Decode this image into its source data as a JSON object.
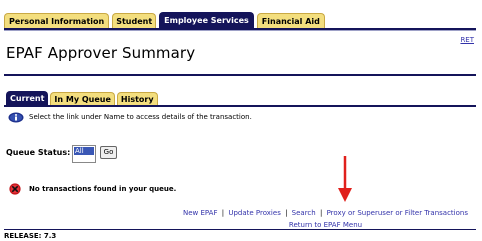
{
  "top_tabs": {
    "personal_information": "Personal Information",
    "student": "Student",
    "employee_services": "Employee Services",
    "financial_aid": "Financial Aid"
  },
  "ret_link": "RET",
  "page_title": "EPAF Approver Summary",
  "sub_tabs": {
    "current": "Current",
    "in_my_queue": "In My Queue",
    "history": "History"
  },
  "info": {
    "text": "Select the link under Name to access details of the transaction.",
    "icon": "info-icon"
  },
  "queue": {
    "label": "Queue Status:",
    "selected": "All",
    "go_label": "Go"
  },
  "message": {
    "text": "No transactions found in your queue.",
    "icon": "error-icon"
  },
  "links": {
    "new_epaf": "New EPAF",
    "update_proxies": "Update Proxies",
    "search": "Search",
    "proxy_filter": "Proxy or Superuser or Filter Transactions",
    "return_menu": "Return to EPAF Menu",
    "separator": "|"
  },
  "release": "RELEASE: 7.3",
  "colors": {
    "navy": "#14145a",
    "tab_gold": "#f3de7e",
    "link_blue": "#3333aa",
    "arrow_red": "#e0201c"
  }
}
